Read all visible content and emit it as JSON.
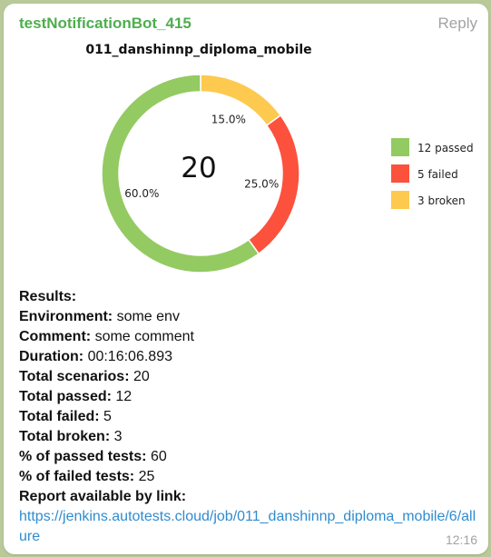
{
  "message": {
    "sender": "testNotificationBot_415",
    "reply_label": "Reply",
    "time": "12:16"
  },
  "chart_data": {
    "type": "pie",
    "title": "011_danshinnp_diploma_mobile",
    "center_label": "20",
    "slices": [
      {
        "label": "12 passed",
        "value": 12,
        "percent": "60.0%",
        "color": "#94ca62"
      },
      {
        "label": "5 failed",
        "value": 5,
        "percent": "25.0%",
        "color": "#fc513c"
      },
      {
        "label": "3 broken",
        "value": 3,
        "percent": "15.0%",
        "color": "#fdc94f"
      }
    ],
    "legend_position": "right"
  },
  "report": {
    "results_label": "Results:",
    "environment_label": "Environment:",
    "environment_value": "some env",
    "comment_label": "Comment:",
    "comment_value": "some comment",
    "duration_label": "Duration:",
    "duration_value": "00:16:06.893",
    "scenarios_label": "Total scenarios:",
    "scenarios_value": "20",
    "passed_label": "Total passed:",
    "passed_value": "12",
    "failed_label": "Total failed:",
    "failed_value": "5",
    "broken_label": "Total broken:",
    "broken_value": "3",
    "pct_passed_label": "% of passed tests:",
    "pct_passed_value": "60",
    "pct_failed_label": "% of failed tests:",
    "pct_failed_value": "25",
    "link_label": "Report available by link:",
    "link_url": "https://jenkins.autotests.cloud/job/011_danshinnp_diploma_mobile/6/allure"
  }
}
